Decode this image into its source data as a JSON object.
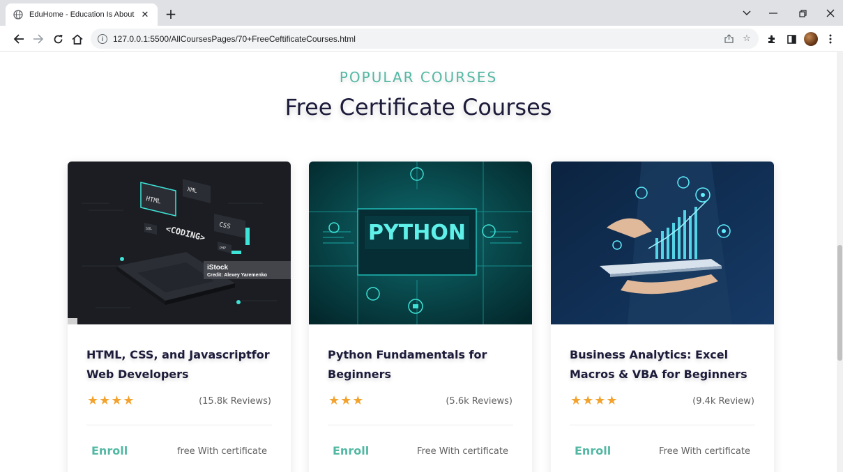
{
  "browser": {
    "tab_title": "EduHome - Education Is About A",
    "url": "127.0.0.1:5500/AllCoursesPages/70+FreeCeftificateCourses.html"
  },
  "section": {
    "subtitle": "POPULAR COURSES",
    "title": "Free Certificate Courses"
  },
  "courses": [
    {
      "title": "HTML, CSS, and Javascriptfor Web Developers",
      "stars": "★★★★",
      "rating": 4,
      "reviews": "(15.8k Reviews)",
      "enroll": "Enroll",
      "price": "free With certificate",
      "image": {
        "labels": [
          "HTML",
          "XML",
          "CSS",
          "<CODING>",
          "SQL",
          "PHP"
        ],
        "watermark_brand": "iStock",
        "watermark_credit": "Credit: Alexey Yaremenko"
      }
    },
    {
      "title": "Python Fundamentals for Beginners",
      "stars": "★★★",
      "rating": 3,
      "reviews": "(5.6k Reviews)",
      "enroll": "Enroll",
      "price": "Free With certificate",
      "image": {
        "label": "PYTHON"
      }
    },
    {
      "title": "Business Analytics: Excel Macros & VBA for Beginners",
      "stars": "★★★★",
      "rating": 4,
      "reviews": "(9.4k Review)",
      "enroll": "Enroll",
      "price": "Free With certificate",
      "image": {}
    }
  ],
  "colors": {
    "accent": "#53b8a3",
    "heading": "#1c1b3a",
    "star": "#f2a22d",
    "muted_text": "#606060"
  },
  "icons": [
    "globe-icon",
    "close-icon",
    "plus-icon",
    "chevron-down-icon",
    "minimize-icon",
    "restore-icon",
    "window-close-icon",
    "back-arrow-icon",
    "forward-arrow-icon",
    "reload-icon",
    "home-icon",
    "info-icon",
    "share-icon",
    "star-bookmark-icon",
    "extensions-icon",
    "sidepanel-icon",
    "more-menu-icon"
  ]
}
